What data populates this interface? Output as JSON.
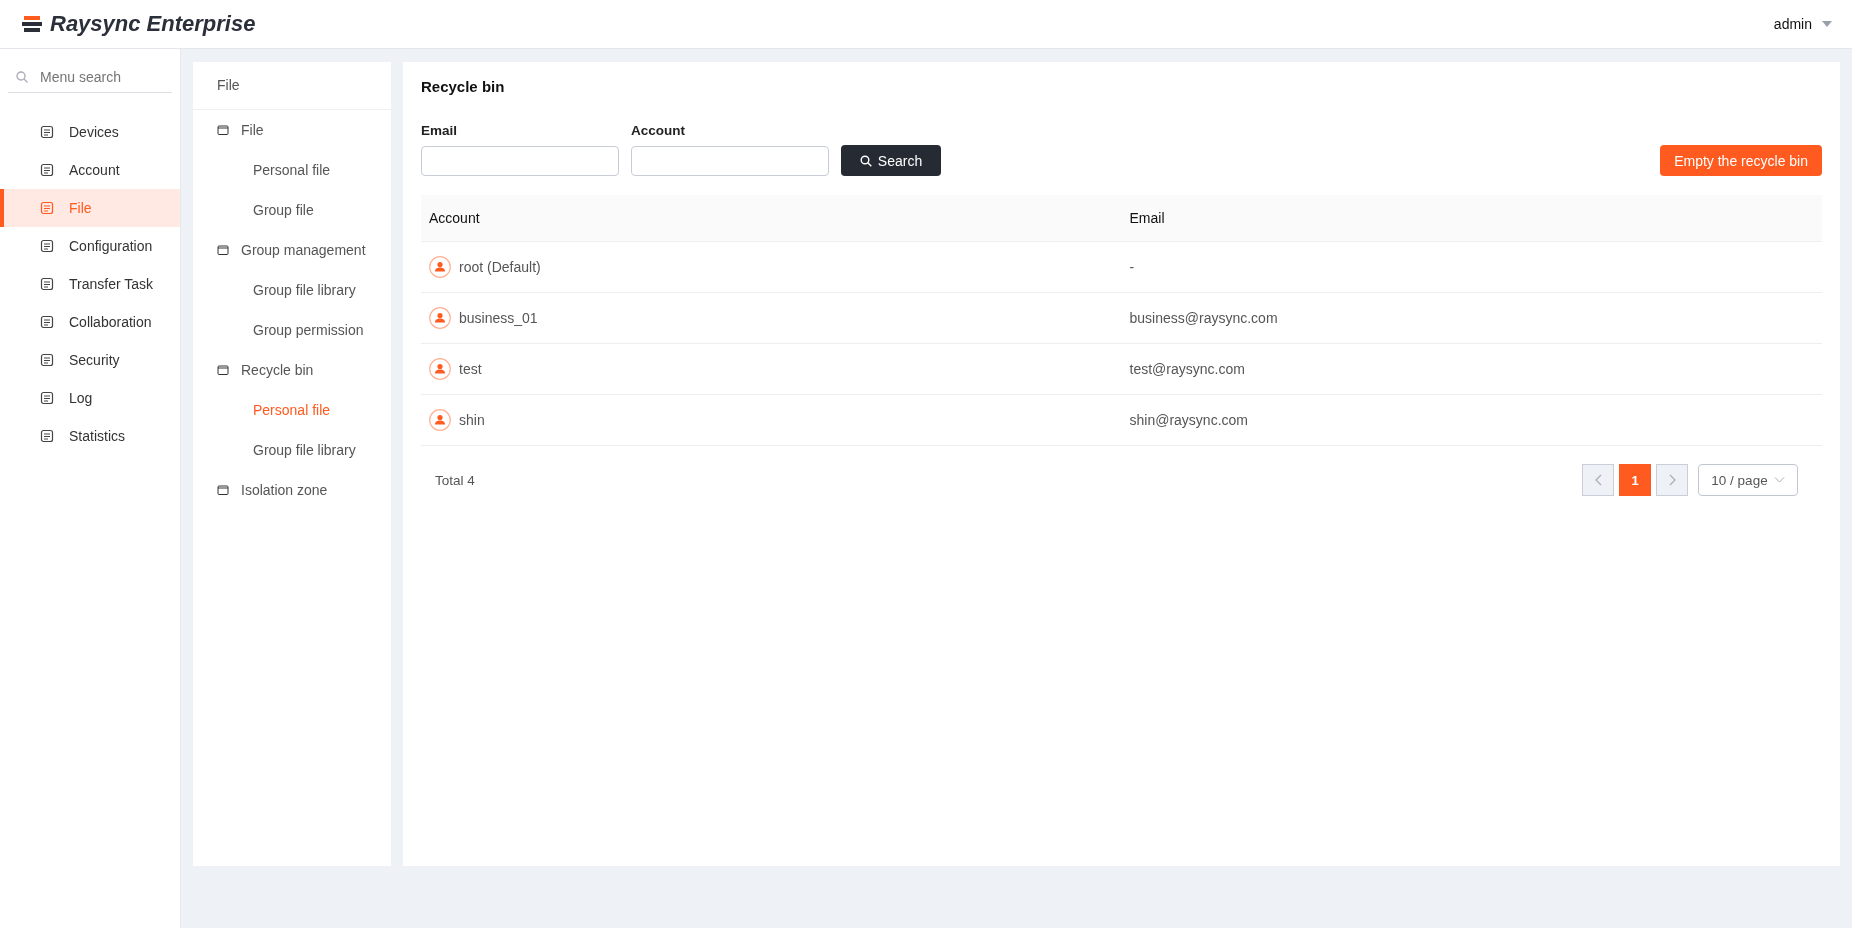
{
  "header": {
    "brand": "Raysync Enterprise",
    "user": "admin"
  },
  "sidebar": {
    "search_placeholder": "Menu search",
    "items": [
      {
        "label": "Devices",
        "selected": false
      },
      {
        "label": "Account",
        "selected": false
      },
      {
        "label": "File",
        "selected": true
      },
      {
        "label": "Configuration",
        "selected": false
      },
      {
        "label": "Transfer Task",
        "selected": false
      },
      {
        "label": "Collaboration",
        "selected": false
      },
      {
        "label": "Security",
        "selected": false
      },
      {
        "label": "Log",
        "selected": false
      },
      {
        "label": "Statistics",
        "selected": false
      }
    ]
  },
  "submenu": {
    "title": "File",
    "groups": [
      {
        "label": "File",
        "children": [
          {
            "label": "Personal file",
            "selected": false
          },
          {
            "label": "Group file",
            "selected": false
          }
        ]
      },
      {
        "label": "Group management",
        "children": [
          {
            "label": "Group file library",
            "selected": false
          },
          {
            "label": "Group permission",
            "selected": false
          }
        ]
      },
      {
        "label": "Recycle bin",
        "children": [
          {
            "label": "Personal file",
            "selected": true
          },
          {
            "label": "Group file library",
            "selected": false
          }
        ]
      },
      {
        "label": "Isolation zone"
      }
    ]
  },
  "main": {
    "title": "Recycle bin",
    "filters": [
      {
        "label": "Email"
      },
      {
        "label": "Account"
      }
    ],
    "search_button": "Search",
    "empty_button": "Empty the recycle bin",
    "table": {
      "columns": [
        "Account",
        "Email"
      ],
      "rows": [
        {
          "account": "root (Default)",
          "email": "-"
        },
        {
          "account": "business_01",
          "email": "business@raysync.com"
        },
        {
          "account": "test",
          "email": "test@raysync.com"
        },
        {
          "account": "shin",
          "email": "shin@raysync.com"
        }
      ]
    },
    "total": "Total 4",
    "pagination": {
      "pages": [
        {
          "label": "1",
          "selected": true
        }
      ],
      "page_size": "10 / page"
    }
  }
}
